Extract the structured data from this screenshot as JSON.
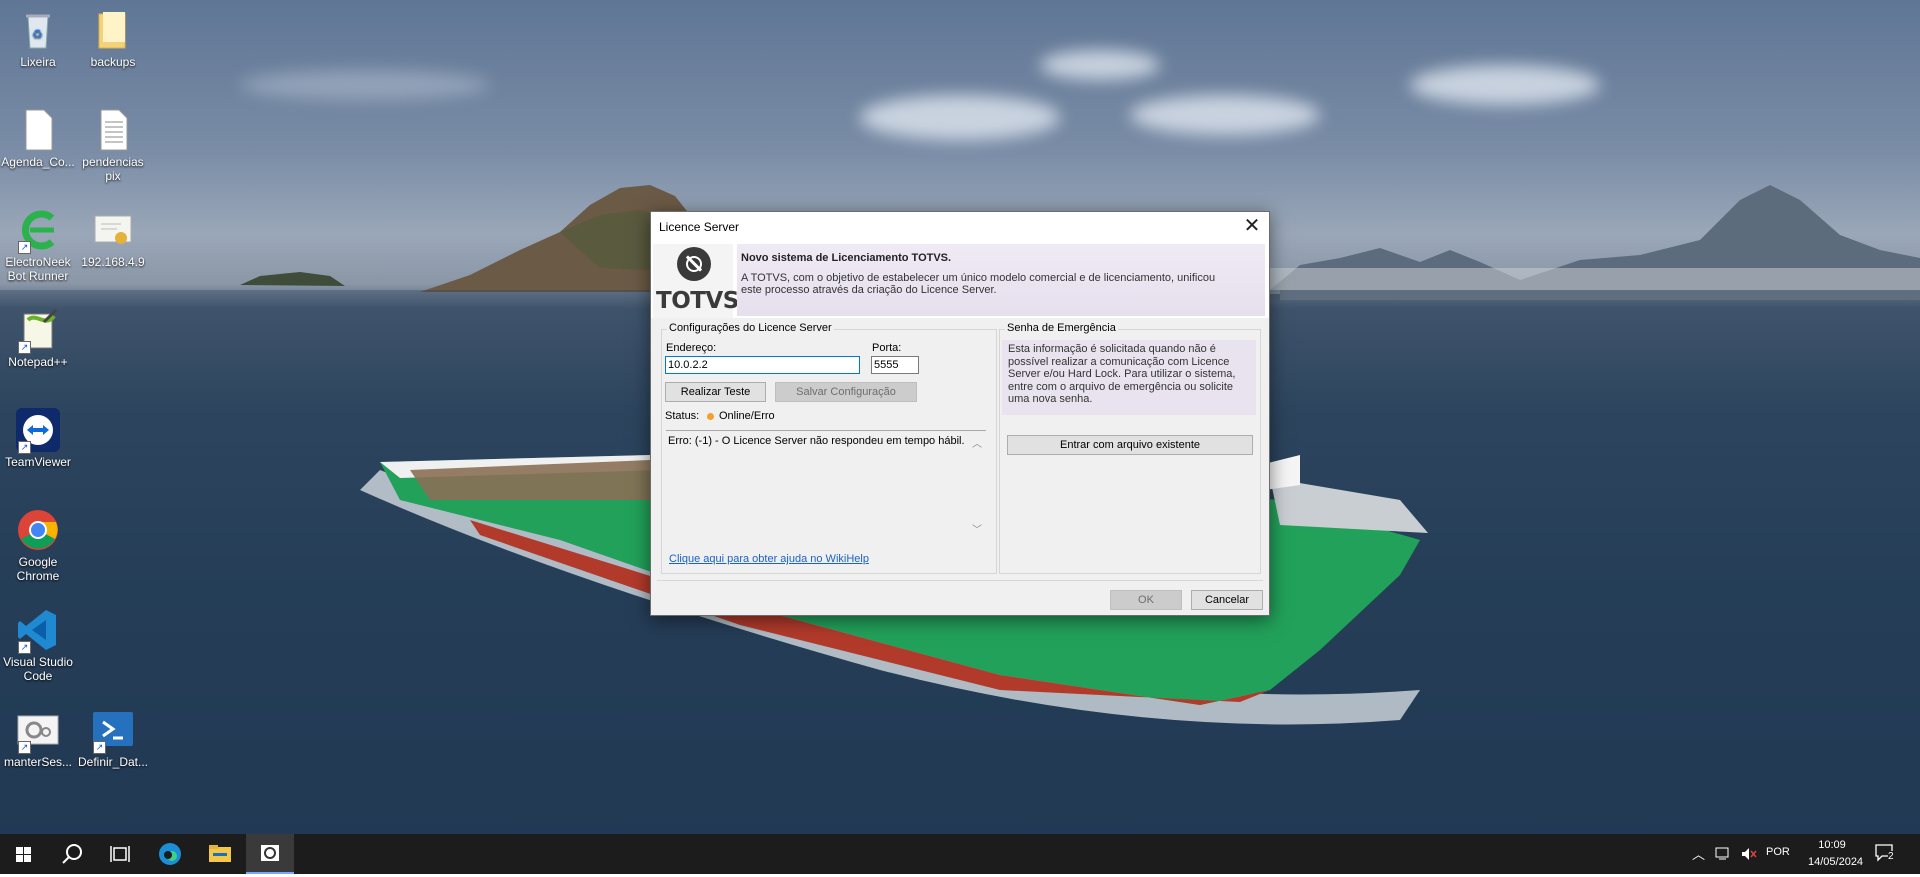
{
  "desktop": {
    "icons": [
      {
        "label": "Lixeira"
      },
      {
        "label": "backups"
      },
      {
        "label": "Agenda_Co..."
      },
      {
        "label": "pendencias pix"
      },
      {
        "label": "ElectroNeek Bot Runner"
      },
      {
        "label": "192.168.4.9"
      },
      {
        "label": "Notepad++"
      },
      {
        "label": "TeamViewer"
      },
      {
        "label": "Google Chrome"
      },
      {
        "label": "Visual Studio Code"
      },
      {
        "label": "manterSes..."
      },
      {
        "label": "Definir_Dat..."
      }
    ]
  },
  "dialog": {
    "title": "Licence Server",
    "logo_text": "TOTVS",
    "banner_title": "Novo sistema de Licenciamento TOTVS.",
    "banner_desc": "A TOTVS, com o objetivo de estabelecer um único modelo comercial e de licenciamento, unificou este processo através da criação do Licence Server.",
    "config": {
      "legend": "Configurações do Licence Server",
      "address_label": "Endereço:",
      "address_value": "10.0.2.2",
      "port_label": "Porta:",
      "port_value": "5555",
      "test_button": "Realizar Teste",
      "save_button": "Salvar Configuração",
      "status_label": "Status:",
      "status_value": "Online/Erro",
      "error_text": "Erro: (-1) - O Licence Server não respondeu em tempo hábil.",
      "help_link": "Clique aqui para obter ajuda no WikiHelp"
    },
    "emergency": {
      "legend": "Senha de Emergência",
      "desc": "Esta informação é solicitada quando não é possível realizar a comunicação com Licence Server e/ou Hard Lock. Para utilizar o sistema, entre com o arquivo de emergência ou solicite uma nova senha.",
      "file_button": "Entrar com arquivo existente"
    },
    "ok_button": "OK",
    "cancel_button": "Cancelar"
  },
  "taskbar": {
    "language": "POR",
    "time": "10:09",
    "date": "14/05/2024",
    "notifications": "2"
  }
}
